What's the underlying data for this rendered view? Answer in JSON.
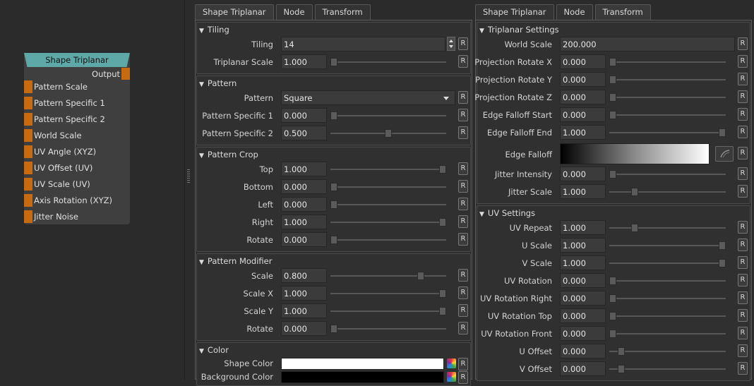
{
  "node": {
    "title": "Shape Triplanar",
    "output": "Output",
    "inputs": [
      "Pattern Scale",
      "Pattern Specific 1",
      "Pattern Specific 2",
      "World Scale",
      "UV Angle (XYZ)",
      "UV Offset (UV)",
      "UV Scale (UV)",
      "Axis Rotation (XYZ)",
      "Jitter Noise"
    ],
    "port_color": "#c86a10",
    "title_color": "#5fa8a8"
  },
  "reset_label": "R",
  "collapse_glyph": "▼",
  "left_panel": {
    "tabs": [
      "Shape Triplanar",
      "Node",
      "Transform"
    ],
    "active_tab": 0,
    "groups": [
      {
        "title": "Tiling",
        "rows": [
          {
            "label": "Tiling",
            "value": "14",
            "type": "spin"
          },
          {
            "label": "Triplanar Scale",
            "value": "1.000",
            "slider": 0.0
          }
        ]
      },
      {
        "title": "Pattern",
        "rows": [
          {
            "label": "Pattern",
            "value": "Square",
            "type": "dropdown"
          },
          {
            "label": "Pattern Specific 1",
            "value": "0.000",
            "slider": 0.0
          },
          {
            "label": "Pattern Specific 2",
            "value": "0.500",
            "slider": 0.5
          }
        ]
      },
      {
        "title": "Pattern Crop",
        "rows": [
          {
            "label": "Top",
            "value": "1.000",
            "slider": 1.0
          },
          {
            "label": "Bottom",
            "value": "0.000",
            "slider": 0.0
          },
          {
            "label": "Left",
            "value": "0.000",
            "slider": 0.0
          },
          {
            "label": "Right",
            "value": "1.000",
            "slider": 1.0
          },
          {
            "label": "Rotate",
            "value": "0.000",
            "slider": 0.0
          }
        ]
      },
      {
        "title": "Pattern Modifier",
        "rows": [
          {
            "label": "Scale",
            "value": "0.800",
            "slider": 0.8
          },
          {
            "label": "Scale X",
            "value": "1.000",
            "slider": 1.0
          },
          {
            "label": "Scale Y",
            "value": "1.000",
            "slider": 1.0
          },
          {
            "label": "Rotate",
            "value": "0.000",
            "slider": 0.0
          }
        ]
      },
      {
        "title": "Color",
        "rows": [
          {
            "label": "Shape Color",
            "type": "color",
            "color": "#ffffff"
          },
          {
            "label": "Background Color",
            "type": "color",
            "color": "#000000"
          }
        ]
      }
    ]
  },
  "right_panel": {
    "tabs": [
      "Shape Triplanar",
      "Node",
      "Transform"
    ],
    "active_tab": 2,
    "groups": [
      {
        "title": "Triplanar Settings",
        "rows": [
          {
            "label": "World Scale",
            "value": "200.000",
            "type": "wide"
          },
          {
            "label": "Projection Rotate X",
            "value": "0.000",
            "slider": 0.0
          },
          {
            "label": "Projection Rotate Y",
            "value": "0.000",
            "slider": 0.0
          },
          {
            "label": "Projection Rotate Z",
            "value": "0.000",
            "slider": 0.0
          },
          {
            "label": "Edge Falloff Start",
            "value": "0.000",
            "slider": 0.0
          },
          {
            "label": "Edge Falloff End",
            "value": "1.000",
            "slider": 1.0
          },
          {
            "label": "Edge Falloff",
            "type": "gradient"
          },
          {
            "label": "Jitter Intensity",
            "value": "0.000",
            "slider": 0.0
          },
          {
            "label": "Jitter Scale",
            "value": "1.000",
            "slider": 0.2
          }
        ]
      },
      {
        "title": "UV Settings",
        "rows": [
          {
            "label": "UV Repeat",
            "value": "1.000",
            "slider": 0.2
          },
          {
            "label": "U Scale",
            "value": "1.000",
            "slider": 1.0
          },
          {
            "label": "V Scale",
            "value": "1.000",
            "slider": 1.0
          },
          {
            "label": "UV Rotation",
            "value": "0.000",
            "slider": 0.0
          },
          {
            "label": "UV Rotation Right",
            "value": "0.000",
            "slider": 0.0
          },
          {
            "label": "UV Rotation Top",
            "value": "0.000",
            "slider": 0.0
          },
          {
            "label": "UV Rotation Front",
            "value": "0.000",
            "slider": 0.0
          },
          {
            "label": "U Offset",
            "value": "0.000",
            "slider": 0.08
          },
          {
            "label": "V Offset",
            "value": "0.000",
            "slider": 0.08
          }
        ]
      }
    ]
  }
}
